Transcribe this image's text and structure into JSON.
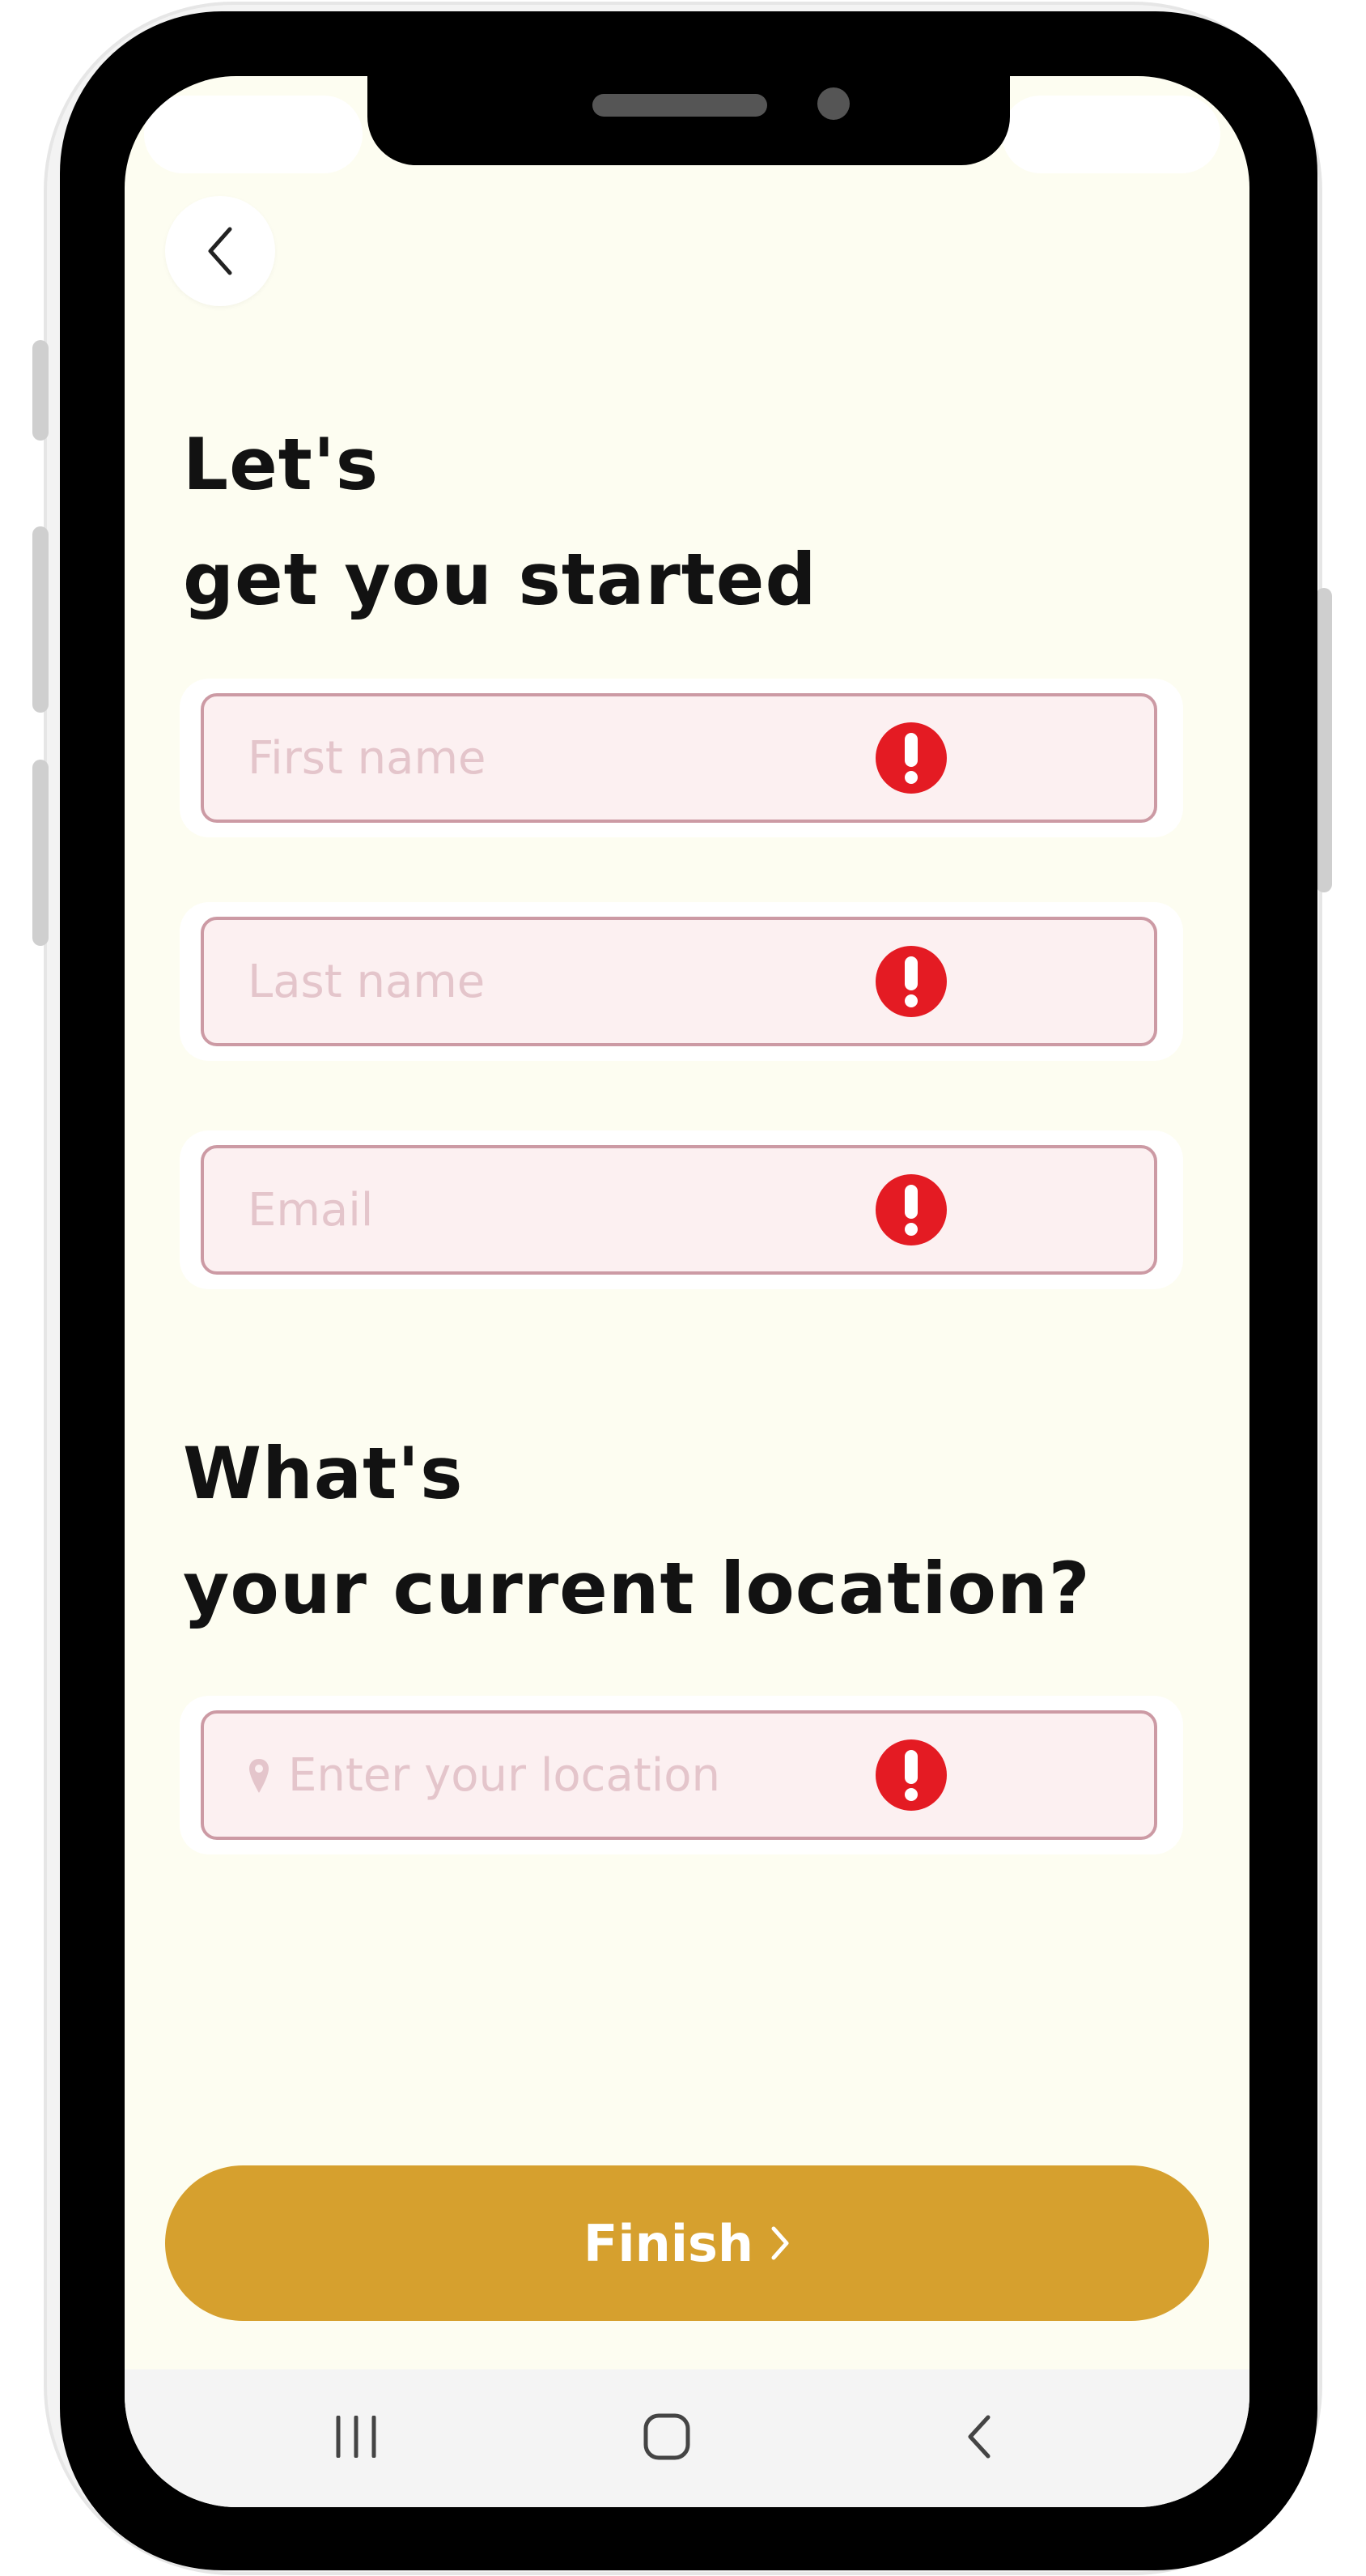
{
  "screen": {
    "title_line1": "Let's",
    "title_line2": "get you started",
    "fields": [
      {
        "placeholder": "First name",
        "value": "",
        "error": true
      },
      {
        "placeholder": "Last name",
        "value": "",
        "error": true
      },
      {
        "placeholder": "Email",
        "value": "",
        "error": true
      }
    ],
    "location": {
      "title_line1": "What's",
      "title_line2": "your current location?",
      "placeholder": "Enter your location",
      "value": "",
      "error": true
    },
    "finish_label": "Finish"
  },
  "icons": {
    "back": "chevron-left-icon",
    "error": "exclamation-circle-icon",
    "location": "map-pin-icon",
    "finish": "chevron-right-icon",
    "nav_recent": "recent-apps-icon",
    "nav_home": "home-icon",
    "nav_back": "back-icon"
  },
  "colors": {
    "background": "#fdfdf1",
    "accent": "#d6a02e",
    "error": "#e41b23",
    "field_background": "#fcf0f1",
    "field_border": "#cc9aa4"
  }
}
